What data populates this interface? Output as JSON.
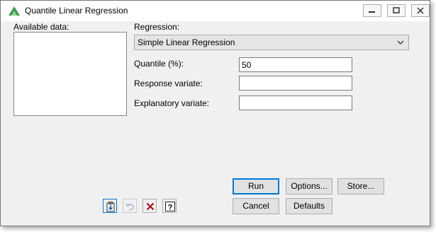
{
  "window": {
    "title": "Quantile Linear Regression",
    "controls": [
      "minimize-icon",
      "maximize-icon",
      "close-icon"
    ]
  },
  "labels": {
    "available_data": "Available data:",
    "regression": "Regression:",
    "quantile": "Quantile (%):",
    "response_variate": "Response variate:",
    "explanatory_variate": "Explanatory variate:"
  },
  "available_data_items": [],
  "regression_select": {
    "selected": "Simple Linear Regression"
  },
  "fields": {
    "quantile": {
      "value": "50"
    },
    "response_variate": {
      "value": ""
    },
    "explanatory_variate": {
      "value": ""
    }
  },
  "buttons": {
    "run": "Run",
    "options": "Options...",
    "store": "Store...",
    "cancel": "Cancel",
    "defaults": "Defaults"
  },
  "toolbar": {
    "icons": [
      "paste-clipboard-icon",
      "undo-icon",
      "clear-icon",
      "help-icon"
    ]
  },
  "colors": {
    "dialog_bg": "#f0f0f0",
    "default_button_border": "#0078d7",
    "clear_icon": "#b0001e",
    "app_icon": "#3c9a4c"
  }
}
